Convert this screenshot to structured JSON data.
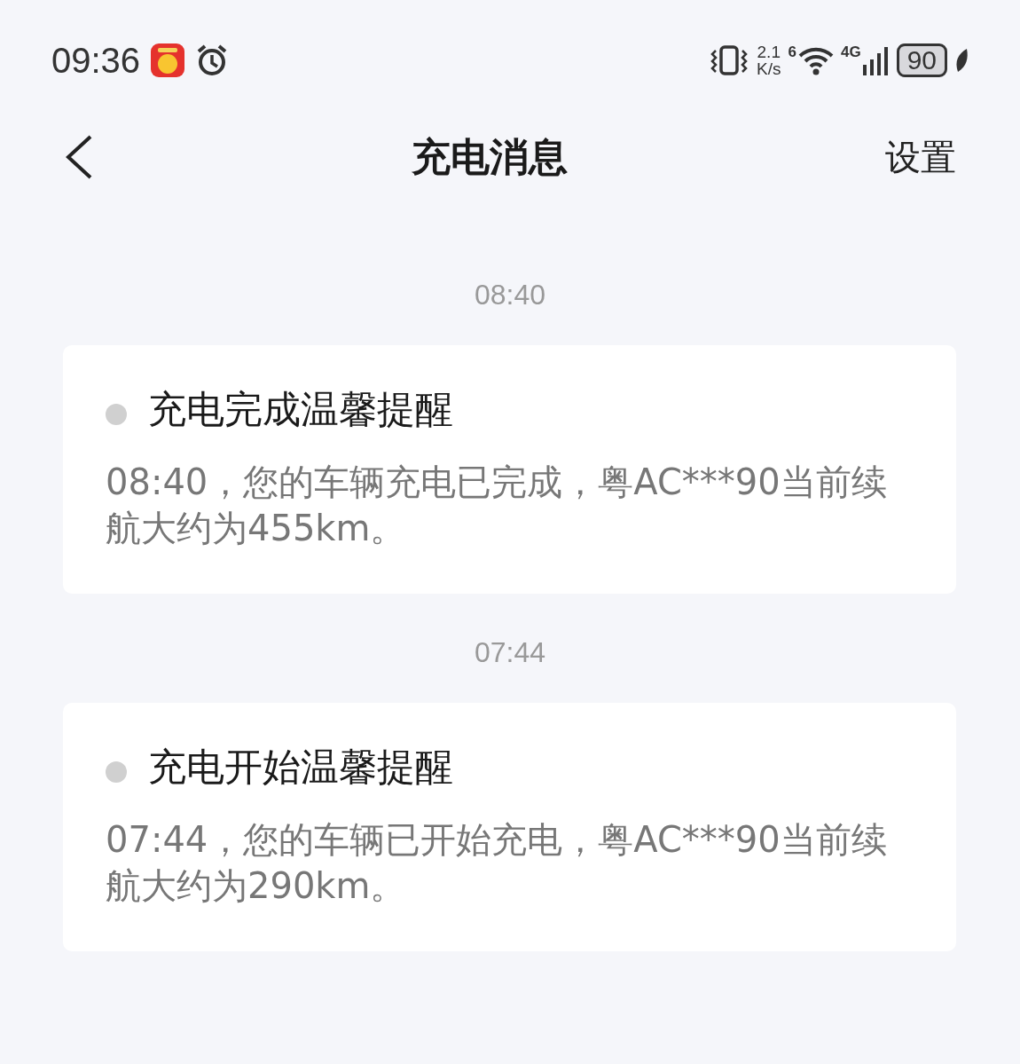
{
  "status_bar": {
    "time": "09:36",
    "speed_value": "2.1",
    "speed_unit": "K/s",
    "wifi_label": "6",
    "network": "4G",
    "battery": "90"
  },
  "header": {
    "title": "充电消息",
    "action": "设置"
  },
  "messages": [
    {
      "time": "08:40",
      "title": "充电完成温馨提醒",
      "body": "08:40，您的车辆充电已完成，粤AC***90当前续航大约为455km。",
      "unread": false
    },
    {
      "time": "07:44",
      "title": "充电开始温馨提醒",
      "body": "07:44，您的车辆已开始充电，粤AC***90当前续航大约为290km。",
      "unread": false
    }
  ]
}
